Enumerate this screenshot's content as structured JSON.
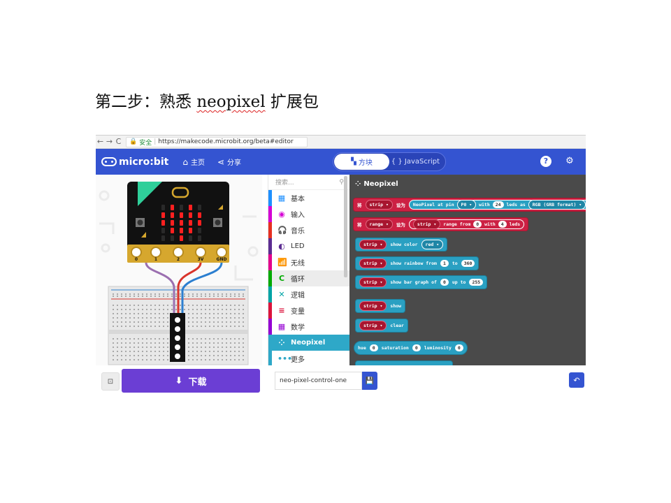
{
  "slide": {
    "title_prefix": "第二步：熟悉 ",
    "title_word": "neopixel",
    "title_suffix": " 扩展包"
  },
  "browser": {
    "back": "←",
    "forward": "→",
    "reload": "C",
    "lock": "🔒",
    "secure_label": "安全",
    "url": "https://makecode.microbit.org/beta#editor"
  },
  "header": {
    "logo_text": "micro:bit",
    "home_label": "主页",
    "share_label": "分享",
    "blocks_tab": "方块",
    "js_tab": "{ } JavaScript",
    "help": "?",
    "settings": "⚙"
  },
  "simulator": {
    "pin_labels": [
      "0",
      "1",
      "2",
      "3V",
      "GND"
    ],
    "led_matrix": [
      [
        0,
        1,
        0,
        1,
        0
      ],
      [
        1,
        1,
        1,
        1,
        1
      ],
      [
        1,
        1,
        1,
        1,
        1
      ],
      [
        0,
        1,
        1,
        1,
        0
      ],
      [
        0,
        0,
        1,
        0,
        0
      ]
    ],
    "colors": {
      "board": "#111111",
      "led_on": "#ff2020",
      "edge": "#d6a72e",
      "wire_purple": "#9b6fb0",
      "wire_red": "#d9342b",
      "wire_blue": "#2c7fd0"
    }
  },
  "menu": {
    "search_placeholder": "搜索...",
    "search_icon": "search-icon",
    "items": [
      {
        "label": "基本",
        "icon": "▦",
        "color": "#1e90ff"
      },
      {
        "label": "输入",
        "icon": "◉",
        "color": "#d400d4"
      },
      {
        "label": "音乐",
        "icon": "🎧",
        "color": "#e63022"
      },
      {
        "label": "LED",
        "icon": "◐",
        "color": "#5c2d91"
      },
      {
        "label": "无线",
        "icon": "📶",
        "color": "#e3008c"
      },
      {
        "label": "循环",
        "icon": "C",
        "color": "#00aa00"
      },
      {
        "label": "逻辑",
        "icon": "✕",
        "color": "#00a4a6"
      },
      {
        "label": "变量",
        "icon": "≡",
        "color": "#dc143c"
      },
      {
        "label": "数学",
        "icon": "▦",
        "color": "#9400d3"
      },
      {
        "label": "Neopixel",
        "icon": "⁘",
        "color": "#2ea8c8"
      },
      {
        "label": "更多",
        "icon": "•••",
        "color": "#2ea8c8"
      }
    ]
  },
  "flyout": {
    "title": "Neopixel",
    "b1": {
      "set": "将",
      "var": "strip",
      "to": "设为",
      "t1": "NeoPixel at pin",
      "pin": "P0",
      "t2": "with",
      "n": "24",
      "t3": "leds as",
      "fmt": "RGB (GRB format)"
    },
    "b2": {
      "set": "将",
      "var": "range",
      "to": "设为",
      "strip": "strip",
      "t1": "range from",
      "from": "0",
      "t2": "with",
      "n": "4",
      "t3": "leds"
    },
    "b3": {
      "strip": "strip",
      "t1": "show color",
      "color": "red"
    },
    "b4": {
      "strip": "strip",
      "t1": "show rainbow from",
      "a": "1",
      "t2": "to",
      "b": "360"
    },
    "b5": {
      "strip": "strip",
      "t1": "show bar graph of",
      "a": "0",
      "t2": "up to",
      "b": "255"
    },
    "b6": {
      "strip": "strip",
      "t1": "show"
    },
    "b7": {
      "strip": "strip",
      "t1": "clear"
    },
    "b8": {
      "t1": "hue",
      "a": "0",
      "t2": "saturation",
      "b": "0",
      "t3": "luminosity",
      "c": "0"
    }
  },
  "bottom": {
    "collapse": "⊡",
    "download_label": "下载",
    "download_icon": "⬇",
    "project_name": "neo-pixel-control-one",
    "save": "💾",
    "undo": "↶"
  }
}
